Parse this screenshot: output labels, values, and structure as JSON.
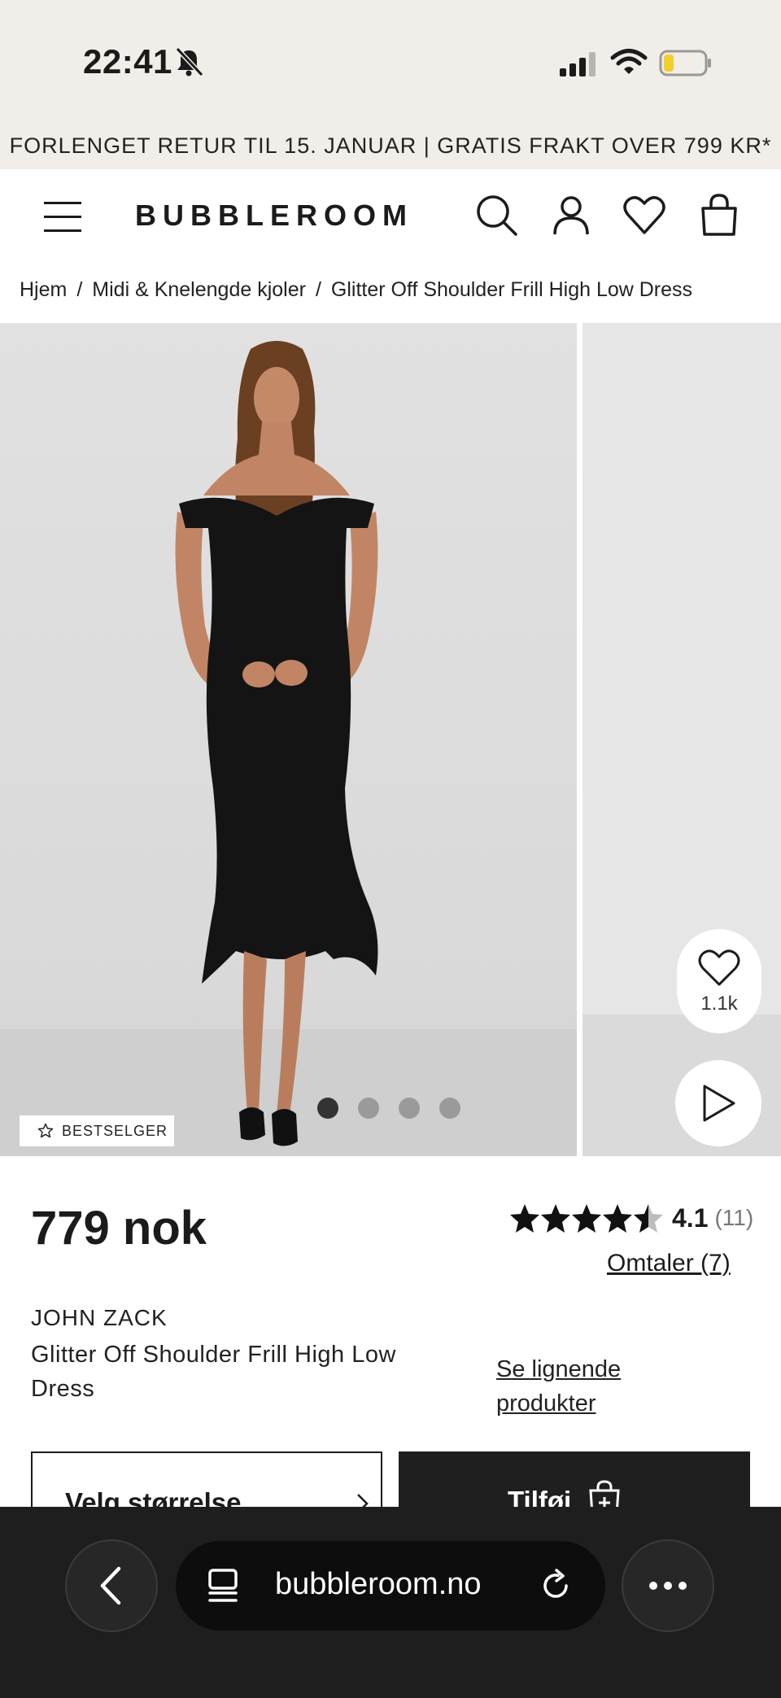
{
  "status_bar": {
    "time": "22:41"
  },
  "promo": {
    "text": "FORLENGET RETUR TIL 15. JANUAR | GRATIS FRAKT OVER 799 KR*"
  },
  "header": {
    "logo": "BUBBLEROOM"
  },
  "breadcrumb": {
    "items": [
      "Hjem",
      "Midi & Knelengde kjoler",
      "Glitter Off Shoulder Frill High Low Dress"
    ],
    "separator": "/"
  },
  "gallery": {
    "badge": "BESTSELGER",
    "dots_total": 4,
    "active_dot": 1,
    "favorites_count": "1.1k"
  },
  "product": {
    "price": "779 nok",
    "rating_value": "4.1",
    "rating_count": "(11)",
    "rating_stars": 4.1,
    "reviews_link": "Omtaler (7)",
    "brand": "JOHN ZACK",
    "name": "Glitter Off Shoulder Frill High Low Dress",
    "similar_link": "Se lignende produkter",
    "size_button": "Velg størrelse",
    "add_button": "Tilføj"
  },
  "browser": {
    "url": "bubbleroom.no"
  },
  "colors": {
    "cream": "#f1ede8",
    "dark": "#1e1e1e",
    "text": "#1b1b1b"
  }
}
